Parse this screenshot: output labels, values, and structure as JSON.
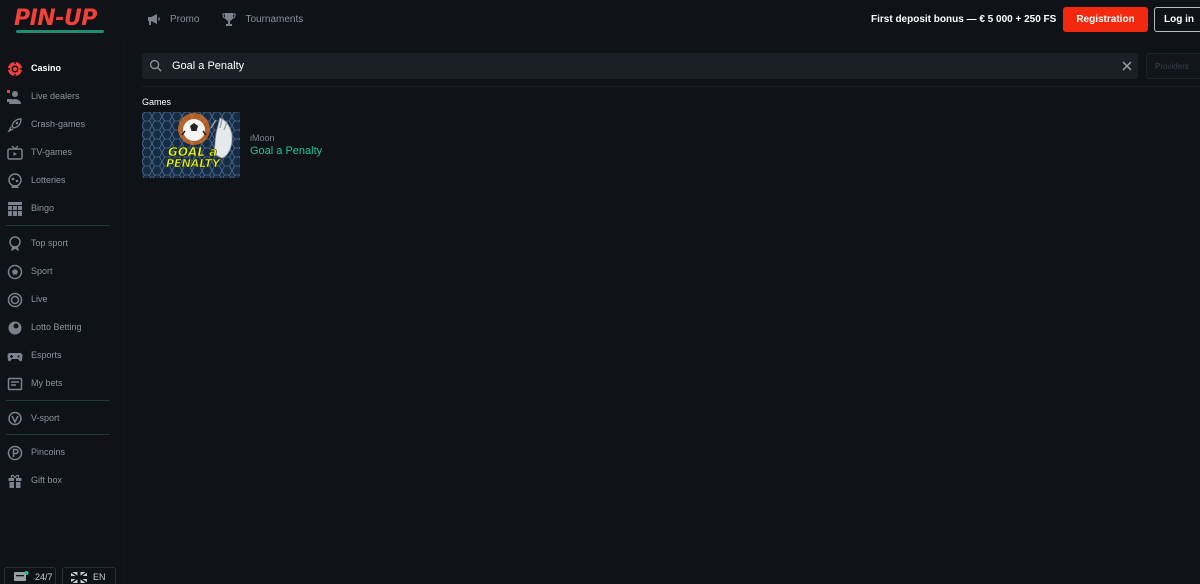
{
  "header": {
    "logo": "PIN-UP",
    "nav": [
      {
        "label": "Promo",
        "icon": "megaphone-icon"
      },
      {
        "label": "Tournaments",
        "icon": "trophy-icon"
      }
    ],
    "bonus": "First deposit bonus — € 5 000 + 250 FS",
    "registration_label": "Registration",
    "login_label": "Log in"
  },
  "sidebar": {
    "items": [
      {
        "label": "Casino",
        "icon": "casino-chip-icon",
        "active": true
      },
      {
        "label": "Live dealers",
        "icon": "live-dealer-icon"
      },
      {
        "label": "Crash-games",
        "icon": "rocket-icon"
      },
      {
        "label": "TV-games",
        "icon": "tv-icon"
      },
      {
        "label": "Lotteries",
        "icon": "lottery-icon"
      },
      {
        "label": "Bingo",
        "icon": "bingo-icon"
      },
      {
        "label": "Top sport",
        "icon": "top-sport-icon"
      },
      {
        "label": "Sport",
        "icon": "soccer-ball-icon"
      },
      {
        "label": "Live",
        "icon": "live-icon"
      },
      {
        "label": "Lotto Betting",
        "icon": "lotto-ball-icon"
      },
      {
        "label": "Esports",
        "icon": "gamepad-icon"
      },
      {
        "label": "My bets",
        "icon": "bets-icon"
      },
      {
        "label": "V-sport",
        "icon": "v-sport-icon"
      },
      {
        "label": "Pincoins",
        "icon": "pincoin-icon"
      },
      {
        "label": "Gift box",
        "icon": "gift-icon"
      }
    ],
    "support_label": "24/7",
    "language_label": "EN"
  },
  "search": {
    "value": "Goal a Penalty",
    "providers_label": "Providers"
  },
  "results": {
    "section_title": "Games",
    "games": [
      {
        "provider": "iMoon",
        "name": "Goal a Penalty",
        "thumb_text_1": "GOAL a",
        "thumb_text_2": "PENALTY"
      }
    ]
  },
  "colors": {
    "background": "#0f1217",
    "brand_red": "#f2413a",
    "registration": "#f2290f",
    "game_title": "#21c48c",
    "divider": "#1b3a37"
  }
}
